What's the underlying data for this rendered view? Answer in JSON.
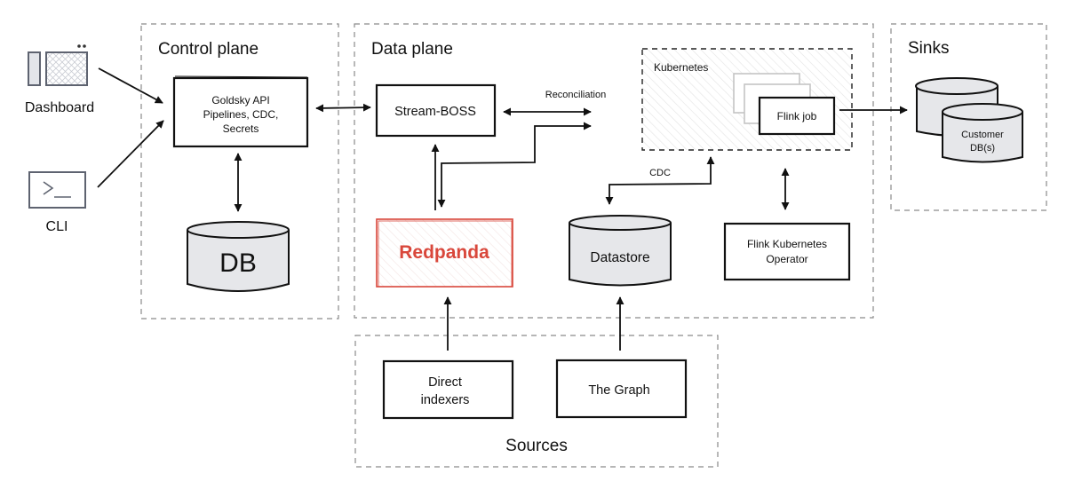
{
  "groups": {
    "control_plane": "Control plane",
    "data_plane": "Data plane",
    "sinks": "Sinks",
    "sources": "Sources",
    "kubernetes": "Kubernetes"
  },
  "clients": {
    "dashboard": {
      "label": "Dashboard",
      "icon": "dashboard-window-icon"
    },
    "cli": {
      "label": "CLI",
      "icon": "terminal-prompt-icon",
      "glyph": ">_"
    }
  },
  "nodes": {
    "goldsky_api": {
      "lines": [
        "Goldsky API",
        "Pipelines, CDC,",
        "Secrets"
      ]
    },
    "db": {
      "label": "DB"
    },
    "stream_boss": {
      "label": "Stream-BOSS"
    },
    "redpanda": {
      "label": "Redpanda"
    },
    "datastore": {
      "label": "Datastore"
    },
    "flink_job": {
      "label": "Flink job"
    },
    "flink_operator": {
      "lines": [
        "Flink Kubernetes",
        "Operator"
      ]
    },
    "customer_db": {
      "lines": [
        "Customer",
        "DB(s)"
      ]
    },
    "direct_indexers": {
      "lines": [
        "Direct",
        "indexers"
      ]
    },
    "the_graph": {
      "label": "The Graph"
    }
  },
  "edge_labels": {
    "reconciliation": "Reconciliation",
    "cdc": "CDC"
  },
  "edges": [
    {
      "from": "Dashboard",
      "to": "Goldsky API",
      "direction": "forward"
    },
    {
      "from": "CLI",
      "to": "Goldsky API",
      "direction": "forward"
    },
    {
      "from": "Goldsky API",
      "to": "Stream-BOSS",
      "direction": "both"
    },
    {
      "from": "Goldsky API",
      "to": "DB",
      "direction": "both"
    },
    {
      "from": "Stream-BOSS",
      "to": "Kubernetes",
      "direction": "both",
      "label": "Reconciliation"
    },
    {
      "from": "Redpanda",
      "to": "Stream-BOSS",
      "direction": "forward"
    },
    {
      "from": "Redpanda",
      "to": "Kubernetes",
      "direction": "both"
    },
    {
      "from": "Datastore",
      "to": "Kubernetes",
      "direction": "both",
      "label": "CDC"
    },
    {
      "from": "Kubernetes",
      "to": "Flink Kubernetes Operator",
      "direction": "both"
    },
    {
      "from": "Flink job",
      "to": "Customer DB(s)",
      "direction": "forward"
    },
    {
      "from": "Direct indexers",
      "to": "Redpanda",
      "direction": "forward"
    },
    {
      "from": "The Graph",
      "to": "Datastore",
      "direction": "forward"
    }
  ],
  "colors": {
    "ink": "#111111",
    "dashed_border": "#8a8a8a",
    "cylinder_fill": "#e6e7ea",
    "redpanda": "#d9473b",
    "ghost_card": "#c4c4c4",
    "icon_stroke": "#5e6370",
    "icon_fill": "#e3e5ea"
  }
}
